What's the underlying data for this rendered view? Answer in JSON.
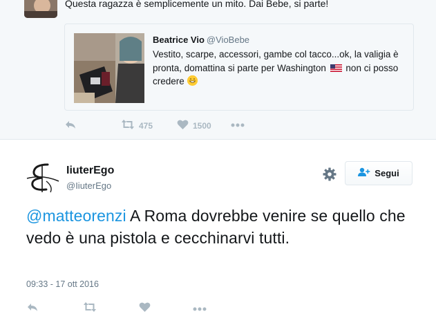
{
  "previous_tweet": {
    "text": "Questa ragazza è semplicemente un mito. Dai Bebe, si parte!",
    "quoted": {
      "name": "Beatrice Vio",
      "handle": "@VioBebe",
      "text_before_flag": "Vestito, scarpe, accessori, gambe col tacco...ok, la valigia è pronta, domattina si parte per Washington",
      "text_after_flag": "non ci posso credere",
      "flag_icon": "us-flag-icon",
      "emoji_icon": "grinning-emoji-icon"
    },
    "actions": {
      "reply_icon": "reply-icon",
      "retweet_count": "475",
      "like_count": "1500",
      "more_icon": "more-icon"
    }
  },
  "main_tweet": {
    "name": "IiuterEgo",
    "handle": "@IiuterEgo",
    "follow_label": "Segui",
    "mention": "@matteorenzi",
    "text": " A Roma dovrebbe venire se quello che vedo è una pistola e cecchinarvi tutti.",
    "timestamp": "09:33 - 17 ott 2016"
  },
  "colors": {
    "link": "#1b95e0",
    "muted": "#657786",
    "icon": "#aab8c2",
    "background_alt": "#f5f8fa"
  }
}
